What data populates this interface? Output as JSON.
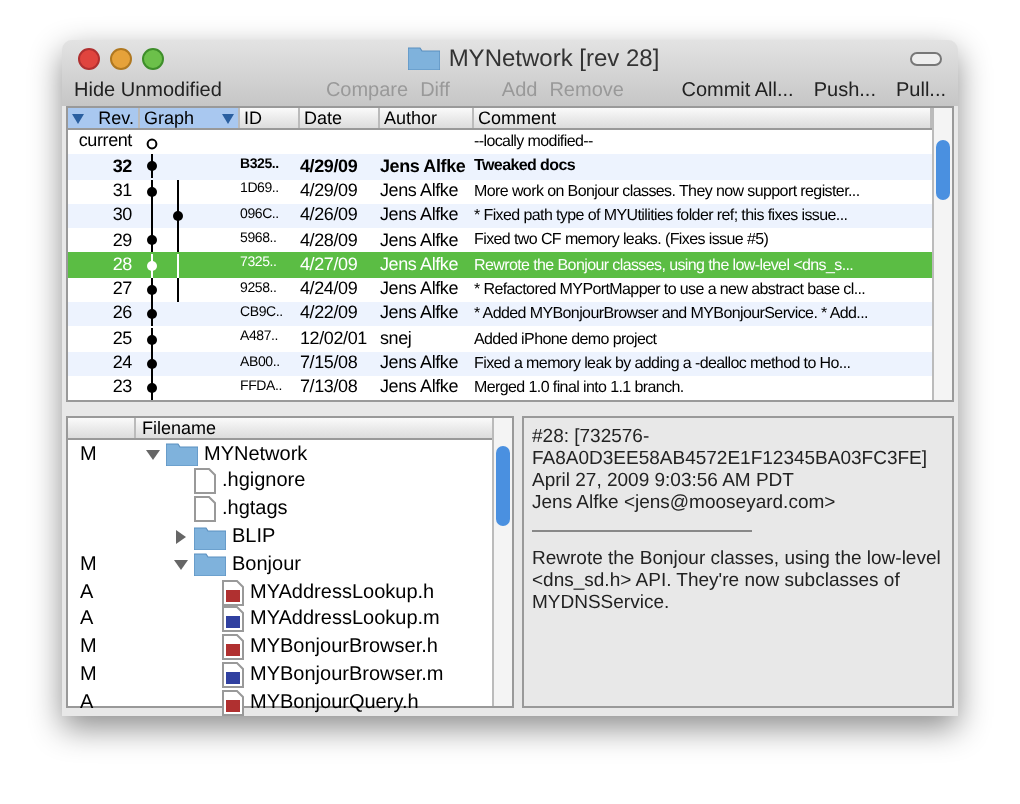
{
  "window": {
    "title": "MYNetwork [rev 28]"
  },
  "toolbar": [
    {
      "label": "Hide Unmodified",
      "disabled": false
    },
    {
      "label": "Compare",
      "disabled": true
    },
    {
      "label": "Diff",
      "disabled": true
    },
    {
      "label": "Add",
      "disabled": true
    },
    {
      "label": "Remove",
      "disabled": true
    },
    {
      "label": "Commit All...",
      "disabled": false
    },
    {
      "label": "Push...",
      "disabled": false
    },
    {
      "label": "Pull...",
      "disabled": false
    }
  ],
  "history": {
    "columns": [
      {
        "label": "Rev.",
        "sorted": true
      },
      {
        "label": "Graph",
        "sorted": true
      },
      {
        "label": "ID",
        "sorted": false
      },
      {
        "label": "Date",
        "sorted": false
      },
      {
        "label": "Author",
        "sorted": false
      },
      {
        "label": "Comment",
        "sorted": false
      }
    ],
    "rows": [
      {
        "rev": "current",
        "kind": "working",
        "branch": false,
        "id": "",
        "date": "",
        "author": "",
        "comment": "--locally modified--",
        "bold": false,
        "selected": false
      },
      {
        "rev": "32",
        "kind": "main",
        "branch": false,
        "id": "B325..",
        "date": "4/29/09",
        "author": "Jens Alfke",
        "comment": "Tweaked docs",
        "bold": true,
        "selected": false
      },
      {
        "rev": "31",
        "kind": "main",
        "branch": true,
        "id": "1D69..",
        "date": "4/29/09",
        "author": "Jens Alfke",
        "comment": "More work on Bonjour classes. They now support register...",
        "bold": false,
        "selected": false
      },
      {
        "rev": "30",
        "kind": "side",
        "branch": true,
        "id": "096C..",
        "date": "4/26/09",
        "author": "Jens Alfke",
        "comment": "* Fixed path type of MYUtilities folder ref; this fixes issue...",
        "bold": false,
        "selected": false
      },
      {
        "rev": "29",
        "kind": "main",
        "branch": true,
        "id": "5968..",
        "date": "4/28/09",
        "author": "Jens Alfke",
        "comment": "Fixed two CF memory leaks. (Fixes issue #5)",
        "bold": false,
        "selected": false
      },
      {
        "rev": "28",
        "kind": "main",
        "branch": true,
        "id": "7325..",
        "date": "4/27/09",
        "author": "Jens Alfke",
        "comment": "Rewrote the Bonjour classes, using the low-level <dns_s...",
        "bold": false,
        "selected": true
      },
      {
        "rev": "27",
        "kind": "main",
        "branch": true,
        "id": "9258..",
        "date": "4/24/09",
        "author": "Jens Alfke",
        "comment": "* Refactored MYPortMapper to use a new abstract base cl...",
        "bold": false,
        "selected": false
      },
      {
        "rev": "26",
        "kind": "main",
        "branch": false,
        "id": "CB9C..",
        "date": "4/22/09",
        "author": "Jens Alfke",
        "comment": "* Added MYBonjourBrowser and MYBonjourService. * Add...",
        "bold": false,
        "selected": false
      },
      {
        "rev": "25",
        "kind": "main",
        "branch": false,
        "id": "A487..",
        "date": "12/02/01",
        "author": "snej",
        "comment": "Added iPhone demo project",
        "bold": false,
        "selected": false
      },
      {
        "rev": "24",
        "kind": "main",
        "branch": false,
        "id": "AB00..",
        "date": "7/15/08",
        "author": "Jens Alfke",
        "comment": "Fixed a memory leak by adding a -dealloc  method to Ho...",
        "bold": false,
        "selected": false
      },
      {
        "rev": "23",
        "kind": "main",
        "branch": false,
        "id": "FFDA..",
        "date": "7/13/08",
        "author": "Jens Alfke",
        "comment": "Merged 1.0 final into 1.1 branch.",
        "bold": false,
        "selected": false
      }
    ]
  },
  "files": {
    "column": "Filename",
    "items": [
      {
        "status": "M",
        "name": "MYNetwork",
        "kind": "folder",
        "expanded": true,
        "children": [
          {
            "name": ".hgignore",
            "kind": "file"
          },
          {
            "name": ".hgtags",
            "kind": "file"
          },
          {
            "name": "BLIP",
            "kind": "folder",
            "expanded": false
          },
          {
            "status": "M",
            "name": "Bonjour",
            "kind": "folder",
            "expanded": true,
            "children": [
              {
                "status": "A",
                "name": "MYAddressLookup.h",
                "kind": "header"
              },
              {
                "status": "A",
                "name": "MYAddressLookup.m",
                "kind": "source"
              },
              {
                "status": "M",
                "name": "MYBonjourBrowser.h",
                "kind": "header"
              },
              {
                "status": "M",
                "name": "MYBonjourBrowser.m",
                "kind": "source"
              },
              {
                "status": "A",
                "name": "MYBonjourQuery.h",
                "kind": "header"
              }
            ]
          }
        ]
      }
    ]
  },
  "details": {
    "header": [
      "#28: [732576-",
      "FA8A0D3EE58AB4572E1F12345BA03FC3FE]",
      "April 27, 2009 9:03:56 AM PDT",
      "Jens Alfke <jens@mooseyard.com>"
    ],
    "message": "Rewrote the Bonjour classes, using the low-level <dns_sd.h> API. They're now subclasses of MYDNSService."
  }
}
